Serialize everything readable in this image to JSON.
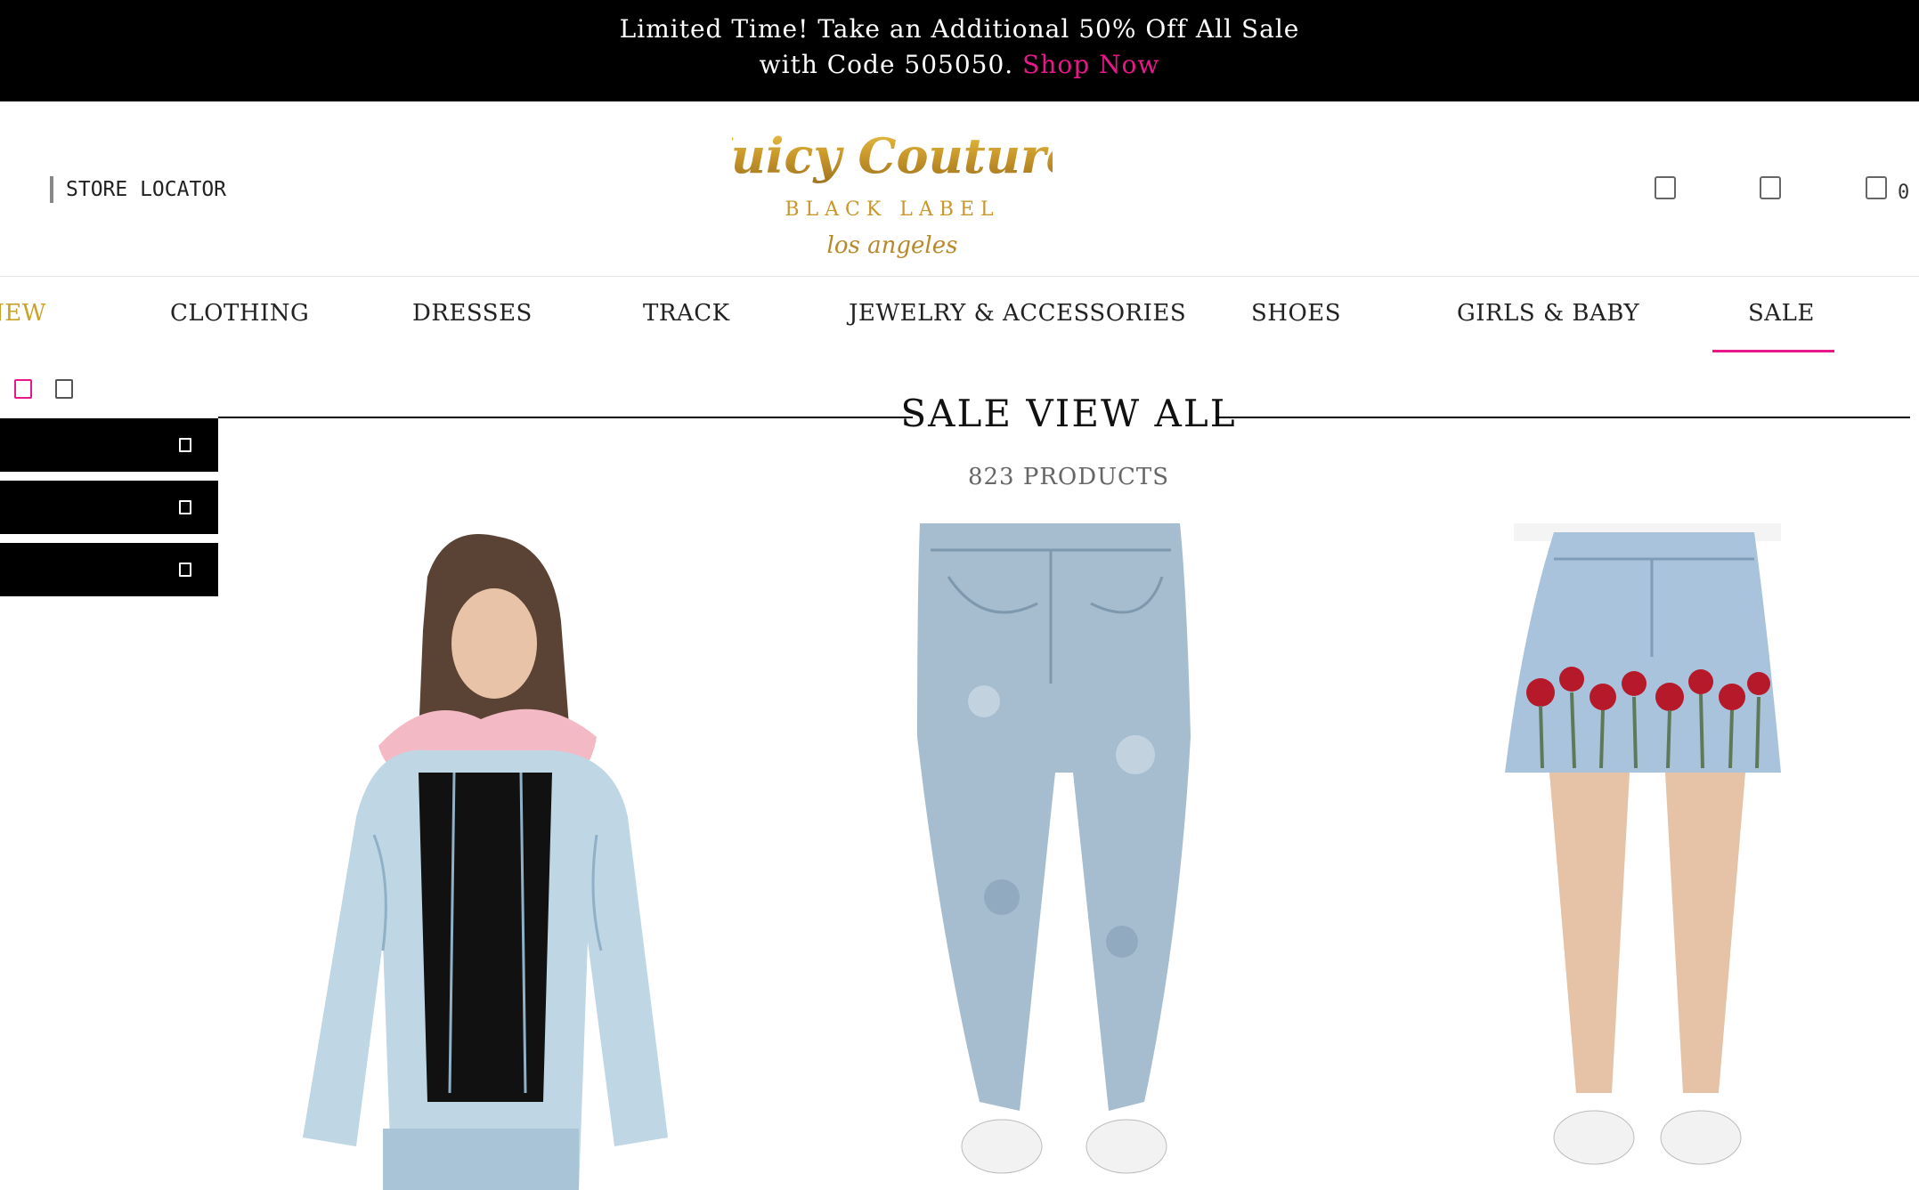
{
  "promo": {
    "line1": "Limited Time! Take an Additional 50% Off All Sale",
    "line2_prefix": "with Code 505050.",
    "link": "Shop Now"
  },
  "header": {
    "store_locator": "STORE LOCATOR",
    "logo": {
      "brand": "Juicy Couture",
      "sub": "BLACK LABEL",
      "city": "los angeles"
    },
    "icons": [
      "search-icon",
      "account-icon",
      "cart-icon"
    ],
    "cart_count": "0"
  },
  "nav": {
    "items": [
      {
        "label": "NEW"
      },
      {
        "label": "CLOTHING"
      },
      {
        "label": "DRESSES"
      },
      {
        "label": "TRACK"
      },
      {
        "label": "JEWELRY & ACCESSORIES"
      },
      {
        "label": "SHOES"
      },
      {
        "label": "GIRLS & BABY"
      },
      {
        "label": "SALE"
      }
    ],
    "active": "SALE"
  },
  "view_toggles": [
    "grid-view-icon",
    "list-view-icon"
  ],
  "filters": [
    "filter-1",
    "filter-2",
    "filter-3"
  ],
  "main": {
    "title": "SALE VIEW ALL",
    "product_count": "823 PRODUCTS"
  },
  "products": [
    {
      "name": "denim-jacket-with-pink-fur-collar"
    },
    {
      "name": "acid-wash-high-waist-jeans"
    },
    {
      "name": "embroidered-floral-denim-skirt"
    }
  ],
  "colors": {
    "accent_pink": "#e8178a",
    "gold": "#c9a227",
    "promo_bg": "#000000"
  }
}
